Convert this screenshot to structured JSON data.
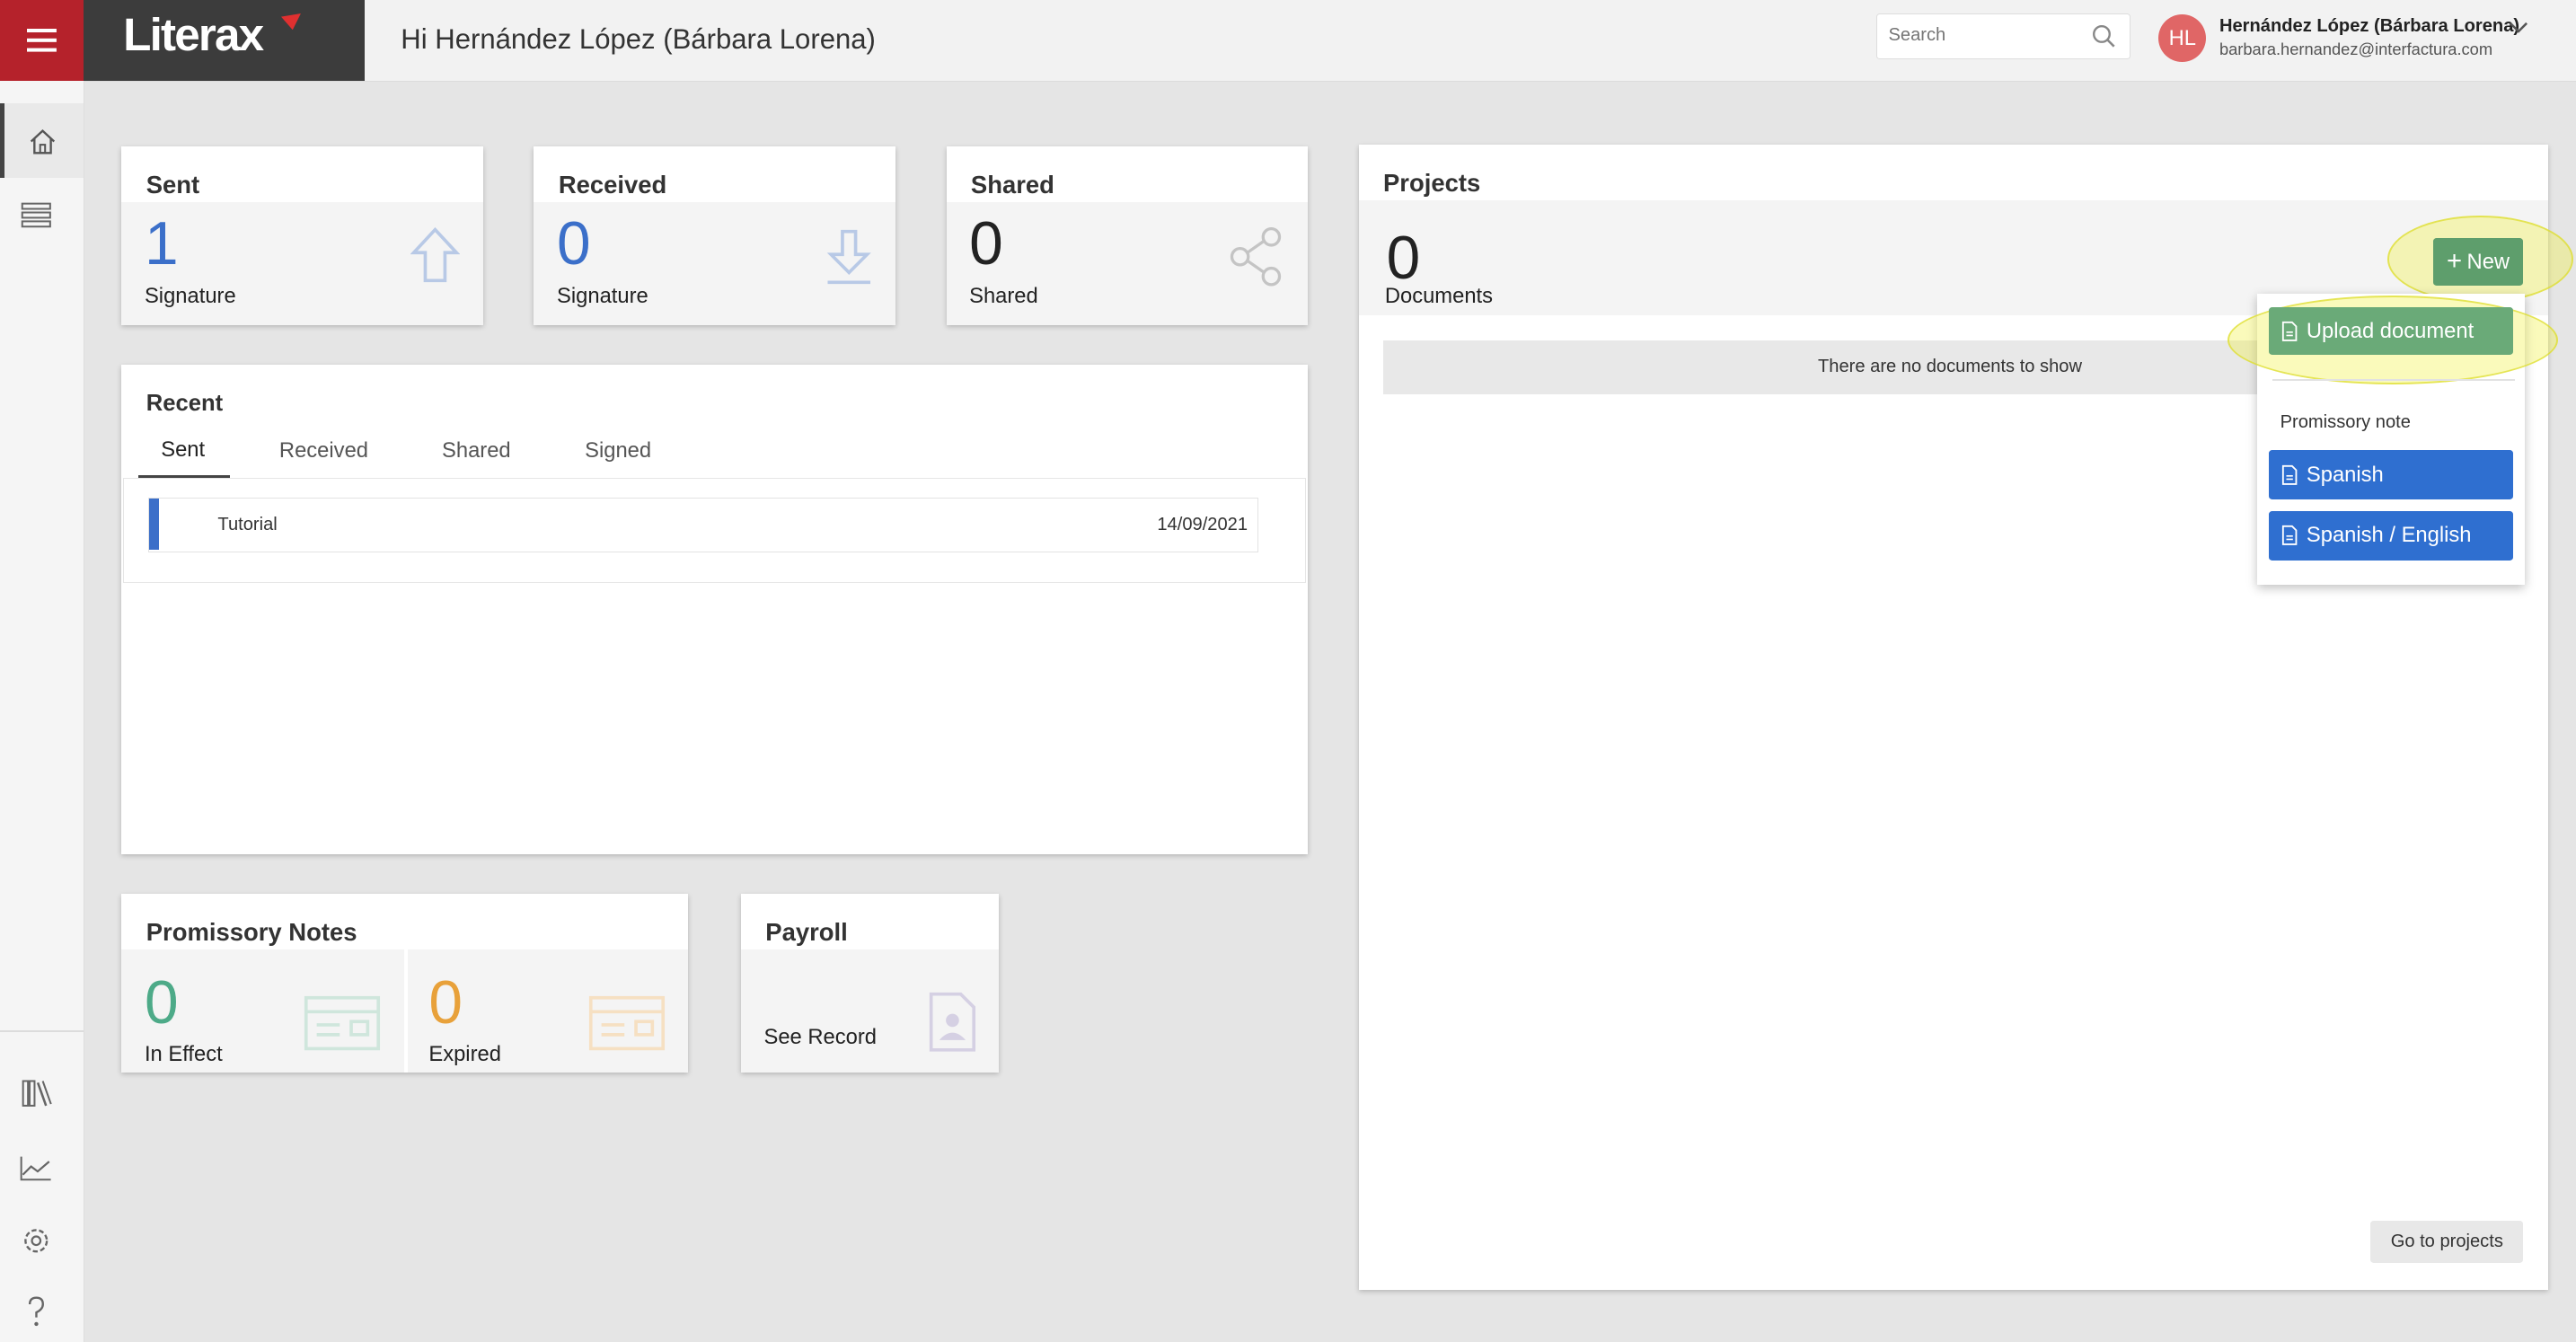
{
  "header": {
    "menu_icon": "hamburger-menu-icon",
    "logo_text": "Literax",
    "greeting": "Hi Hernández López (Bárbara Lorena)",
    "search_placeholder": "Search",
    "user_initials": "HL",
    "user_name": "Hernández López (Bárbara Lorena)",
    "user_email": "barbara.hernandez@interfactura.com"
  },
  "sidebar": {
    "top_icons": [
      "home-icon",
      "list-icon"
    ],
    "bottom_icons": [
      "library-icon",
      "chart-icon",
      "settings-icon",
      "help-icon"
    ]
  },
  "stats": {
    "sent": {
      "title": "Sent",
      "value": "1",
      "label": "Signature",
      "color": "#3b6fc9"
    },
    "received": {
      "title": "Received",
      "value": "0",
      "label": "Signature",
      "color": "#3b6fc9"
    },
    "shared": {
      "title": "Shared",
      "value": "0",
      "label": "Shared",
      "color": "#222222"
    }
  },
  "recent": {
    "title": "Recent",
    "tabs": [
      "Sent",
      "Received",
      "Shared",
      "Signed"
    ],
    "active_tab": "Sent",
    "rows": [
      {
        "name": "Tutorial",
        "date": "14/09/2021"
      }
    ]
  },
  "promissory": {
    "title": "Promissory Notes",
    "in_effect": {
      "value": "0",
      "label": "In Effect",
      "color": "#4daa88"
    },
    "expired": {
      "value": "0",
      "label": "Expired",
      "color": "#e8a13a"
    }
  },
  "payroll": {
    "title": "Payroll",
    "link": "See Record"
  },
  "projects": {
    "title": "Projects",
    "count": "0",
    "count_label": "Documents",
    "empty_message": "There are no documents to show",
    "new_button": "New",
    "goto_button": "Go to projects",
    "dropdown": {
      "upload": "Upload document",
      "section_label": "Promissory note",
      "options": [
        "Spanish",
        "Spanish / English"
      ]
    }
  },
  "colors": {
    "accent_red": "#b5222b",
    "primary_blue": "#2f6fd0",
    "success_green": "#5e9e6c"
  }
}
